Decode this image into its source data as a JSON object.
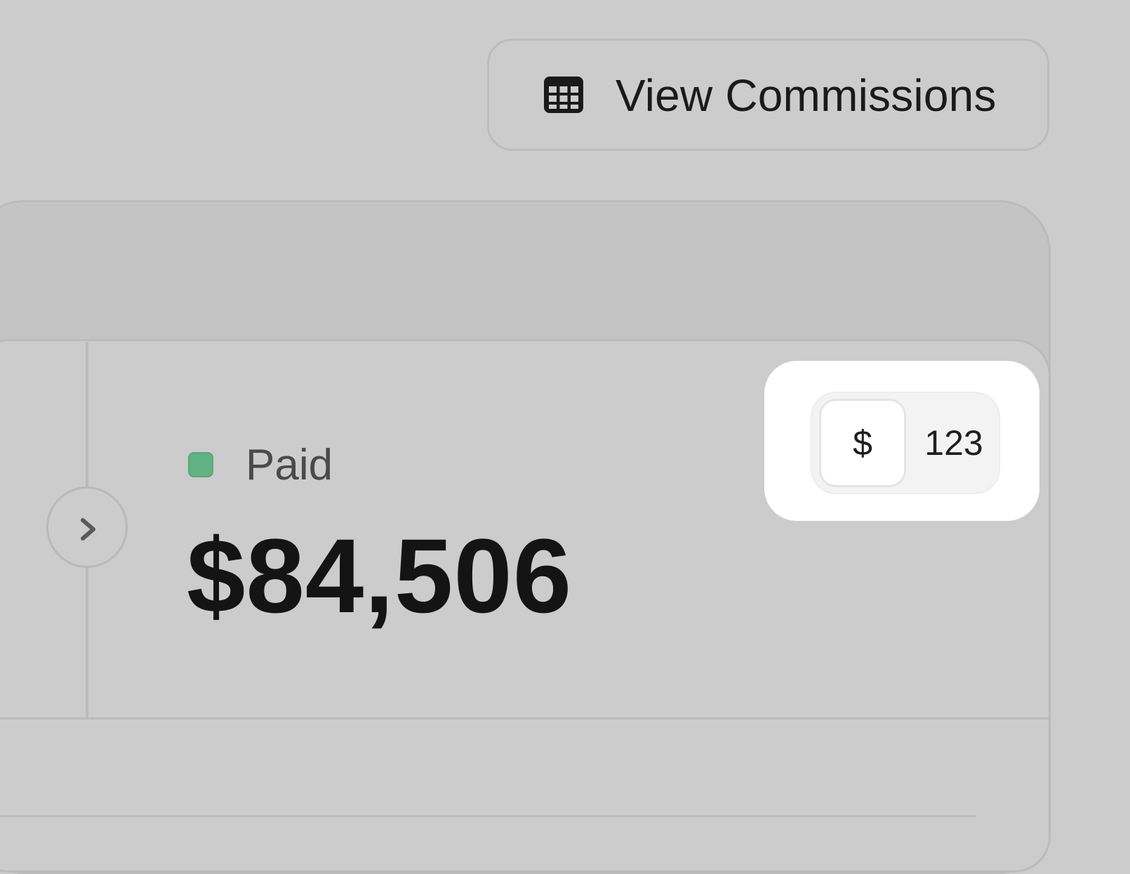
{
  "header": {
    "view_commissions_label": "View Commissions",
    "view_commissions_icon": "table-grid-icon"
  },
  "summary": {
    "status_label": "Paid",
    "status_color": "#63b283",
    "amount": "$84,506",
    "expand_icon": "chevron-right-icon"
  },
  "display_toggle": {
    "options": [
      "$",
      "123"
    ],
    "selected": "$"
  }
}
